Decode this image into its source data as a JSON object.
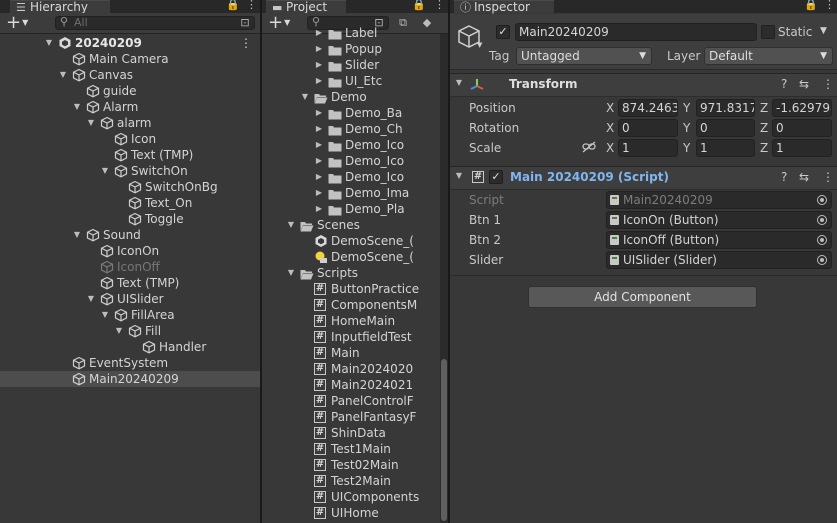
{
  "hierarchy": {
    "tab": "Hierarchy",
    "search_placeholder": "All",
    "rows": [
      {
        "label": "20240209",
        "depth": 0,
        "arrow": "down",
        "icon": "unity-scene",
        "bold": true
      },
      {
        "label": "Main Camera",
        "depth": 1,
        "arrow": "",
        "icon": "cube"
      },
      {
        "label": "Canvas",
        "depth": 1,
        "arrow": "down",
        "icon": "cube"
      },
      {
        "label": "guide",
        "depth": 2,
        "arrow": "",
        "icon": "cube"
      },
      {
        "label": "Alarm",
        "depth": 2,
        "arrow": "down",
        "icon": "cube"
      },
      {
        "label": "alarm",
        "depth": 3,
        "arrow": "down",
        "icon": "cube"
      },
      {
        "label": "Icon",
        "depth": 4,
        "arrow": "",
        "icon": "cube"
      },
      {
        "label": "Text (TMP)",
        "depth": 4,
        "arrow": "",
        "icon": "cube"
      },
      {
        "label": "SwitchOn",
        "depth": 4,
        "arrow": "down",
        "icon": "cube"
      },
      {
        "label": "SwitchOnBg",
        "depth": 5,
        "arrow": "",
        "icon": "cube"
      },
      {
        "label": "Text_On",
        "depth": 5,
        "arrow": "",
        "icon": "cube"
      },
      {
        "label": "Toggle",
        "depth": 5,
        "arrow": "",
        "icon": "cube"
      },
      {
        "label": "Sound",
        "depth": 2,
        "arrow": "down",
        "icon": "cube"
      },
      {
        "label": "IconOn",
        "depth": 3,
        "arrow": "",
        "icon": "cube"
      },
      {
        "label": "IconOff",
        "depth": 3,
        "arrow": "",
        "icon": "cube",
        "dim": true
      },
      {
        "label": "Text (TMP)",
        "depth": 3,
        "arrow": "",
        "icon": "cube"
      },
      {
        "label": "UISlider",
        "depth": 3,
        "arrow": "down",
        "icon": "cube"
      },
      {
        "label": "FillArea",
        "depth": 4,
        "arrow": "down",
        "icon": "cube"
      },
      {
        "label": "Fill",
        "depth": 5,
        "arrow": "down",
        "icon": "cube"
      },
      {
        "label": "Handler",
        "depth": 6,
        "arrow": "",
        "icon": "cube"
      },
      {
        "label": "EventSystem",
        "depth": 1,
        "arrow": "",
        "icon": "cube"
      },
      {
        "label": "Main20240209",
        "depth": 1,
        "arrow": "",
        "icon": "cube",
        "selected": true
      }
    ]
  },
  "project": {
    "tab": "Project",
    "search_placeholder": "",
    "rows": [
      {
        "label": "Label",
        "depth": 3,
        "arrow": "right",
        "icon": "folder"
      },
      {
        "label": "Popup",
        "depth": 3,
        "arrow": "right",
        "icon": "folder"
      },
      {
        "label": "Slider",
        "depth": 3,
        "arrow": "right",
        "icon": "folder"
      },
      {
        "label": "UI_Etc",
        "depth": 3,
        "arrow": "right",
        "icon": "folder"
      },
      {
        "label": "Demo",
        "depth": 2,
        "arrow": "down",
        "icon": "folder-open"
      },
      {
        "label": "Demo_Ba",
        "depth": 3,
        "arrow": "right",
        "icon": "folder"
      },
      {
        "label": "Demo_Ch",
        "depth": 3,
        "arrow": "right",
        "icon": "folder"
      },
      {
        "label": "Demo_Ico",
        "depth": 3,
        "arrow": "right",
        "icon": "folder"
      },
      {
        "label": "Demo_Ico",
        "depth": 3,
        "arrow": "right",
        "icon": "folder"
      },
      {
        "label": "Demo_Ico",
        "depth": 3,
        "arrow": "right",
        "icon": "folder"
      },
      {
        "label": "Demo_Ima",
        "depth": 3,
        "arrow": "right",
        "icon": "folder"
      },
      {
        "label": "Demo_Pla",
        "depth": 3,
        "arrow": "right",
        "icon": "folder"
      },
      {
        "label": "Scenes",
        "depth": 1,
        "arrow": "down",
        "icon": "folder-open"
      },
      {
        "label": "DemoScene_(",
        "depth": 2,
        "arrow": "",
        "icon": "unity-scene"
      },
      {
        "label": "DemoScene_(",
        "depth": 2,
        "arrow": "",
        "icon": "lighting-scene"
      },
      {
        "label": "Scripts",
        "depth": 1,
        "arrow": "down",
        "icon": "folder-open"
      },
      {
        "label": "ButtonPractice",
        "depth": 2,
        "arrow": "",
        "icon": "script"
      },
      {
        "label": "ComponentsM",
        "depth": 2,
        "arrow": "",
        "icon": "script"
      },
      {
        "label": "HomeMain",
        "depth": 2,
        "arrow": "",
        "icon": "script"
      },
      {
        "label": "InputfieldTest",
        "depth": 2,
        "arrow": "",
        "icon": "script"
      },
      {
        "label": "Main",
        "depth": 2,
        "arrow": "",
        "icon": "script"
      },
      {
        "label": "Main2024020",
        "depth": 2,
        "arrow": "",
        "icon": "script"
      },
      {
        "label": "Main2024021",
        "depth": 2,
        "arrow": "",
        "icon": "script"
      },
      {
        "label": "PanelControlF",
        "depth": 2,
        "arrow": "",
        "icon": "script"
      },
      {
        "label": "PanelFantasyF",
        "depth": 2,
        "arrow": "",
        "icon": "script"
      },
      {
        "label": "ShinData",
        "depth": 2,
        "arrow": "",
        "icon": "script"
      },
      {
        "label": "Test1Main",
        "depth": 2,
        "arrow": "",
        "icon": "script"
      },
      {
        "label": "Test02Main",
        "depth": 2,
        "arrow": "",
        "icon": "script"
      },
      {
        "label": "Test2Main",
        "depth": 2,
        "arrow": "",
        "icon": "script"
      },
      {
        "label": "UIComponents",
        "depth": 2,
        "arrow": "",
        "icon": "script"
      },
      {
        "label": "UIHome",
        "depth": 2,
        "arrow": "",
        "icon": "script"
      }
    ]
  },
  "inspector": {
    "tab": "Inspector",
    "object_name": "Main20240209",
    "static_label": "Static",
    "tag_label": "Tag",
    "tag_value": "Untagged",
    "layer_label": "Layer",
    "layer_value": "Default",
    "transform": {
      "title": "Transform",
      "position_label": "Position",
      "rotation_label": "Rotation",
      "scale_label": "Scale",
      "position": {
        "x": "874.2463",
        "y": "971.8317",
        "z": "-1.629798"
      },
      "rotation": {
        "x": "0",
        "y": "0",
        "z": "0"
      },
      "scale": {
        "x": "1",
        "y": "1",
        "z": "1"
      }
    },
    "script_component": {
      "title": "Main 20240209 (Script)",
      "fields": [
        {
          "label": "Script",
          "value": "Main20240209",
          "dim": true
        },
        {
          "label": "Btn 1",
          "value": "IconOn (Button)"
        },
        {
          "label": "Btn 2",
          "value": "IconOff (Button)"
        },
        {
          "label": "Slider",
          "value": "UISlider (Slider)"
        }
      ]
    },
    "add_component": "Add Component",
    "axis_labels": {
      "x": "X",
      "y": "Y",
      "z": "Z"
    }
  }
}
